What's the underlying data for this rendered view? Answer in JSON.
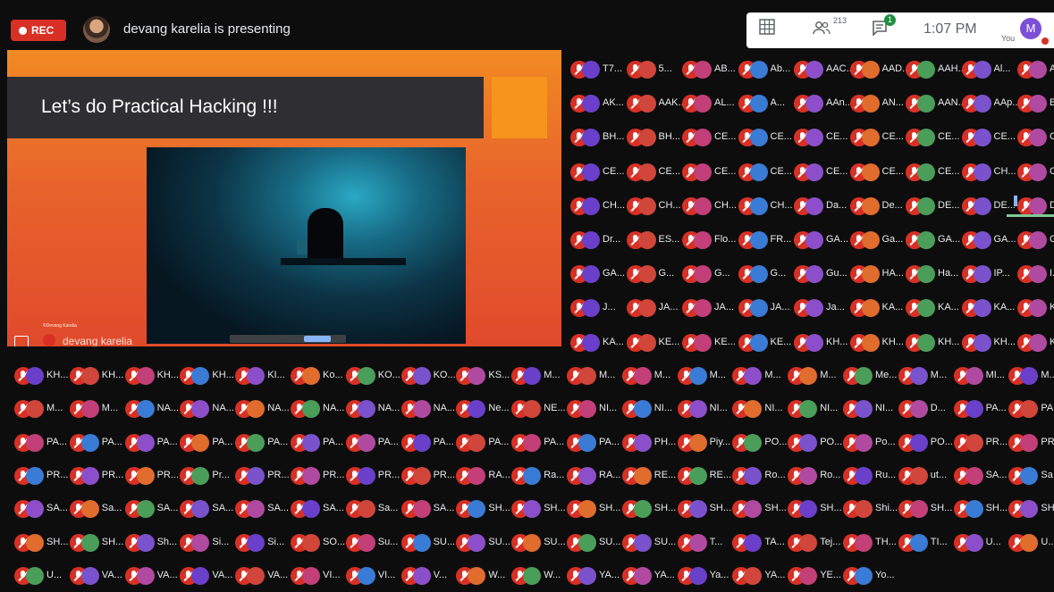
{
  "topbar": {
    "rec_label": "REC",
    "presenting_text": "devang karelia is presenting",
    "people_count": "213",
    "chat_badge": "1",
    "time": "1:07 PM",
    "you_label": "You",
    "you_initial": "M",
    "accent_rec": "#d93025"
  },
  "presentation": {
    "slide_title": "Let’s do Practical Hacking !!!",
    "presenter_name": "devang karelia",
    "credit_text": "©Devang Karelia"
  },
  "participants": [
    "T7...",
    "5...",
    "AB...",
    "Ab...",
    "AAC...",
    "AAD...",
    "AAH...",
    "Al...",
    "Aja",
    "AK...",
    "AAK...",
    "AL...",
    "A...",
    "AAn...",
    "AN...",
    "AAN...",
    "AAp...",
    "BA",
    "BH...",
    "BH...",
    "CE...",
    "CE...",
    "CE...",
    "CE...",
    "CE...",
    "CE...",
    "CE",
    "CE...",
    "CE...",
    "CE...",
    "CE...",
    "CE...",
    "CE...",
    "CE...",
    "CH...",
    "CH",
    "CH...",
    "CH...",
    "CH...",
    "CH...",
    "Da...",
    "De...",
    "DE...",
    "DE...",
    "De...",
    "Dr...",
    "ES...",
    "Flo...",
    "FR...",
    "GA...",
    "Ga...",
    "GA...",
    "GA...",
    "GA",
    "GA...",
    "G...",
    "G...",
    "G...",
    "Gu...",
    "HA...",
    "Ha...",
    "IP...",
    "I...",
    "J...",
    "JA...",
    "JA...",
    "JA...",
    "Ja...",
    "KA...",
    "KA...",
    "KA...",
    "KA",
    "KA...",
    "KE...",
    "KE...",
    "KE...",
    "KH...",
    "KH...",
    "KH...",
    "KH...",
    "KH",
    "KH...",
    "KH...",
    "KH...",
    "KH...",
    "KI...",
    "Ko...",
    "KO...",
    "KO...",
    "KS...",
    "M...",
    "M...",
    "M...",
    "M...",
    "M...",
    "M...",
    "Me...",
    "M...",
    "MI...",
    "M...",
    "M...",
    "M...",
    "NA...",
    "NA...",
    "NA...",
    "NA...",
    "NA...",
    "NA...",
    "Ne...",
    "NE...",
    "NI...",
    "NI...",
    "NI...",
    "NI...",
    "NI...",
    "NI...",
    "D...",
    "PA...",
    "PA",
    "PA...",
    "PA...",
    "PA...",
    "PA...",
    "PA...",
    "PA...",
    "PA...",
    "PA...",
    "PA...",
    "PA...",
    "PA...",
    "PH...",
    "Piy...",
    "PO...",
    "PO...",
    "Po...",
    "PO...",
    "PR...",
    "PR",
    "PR...",
    "PR...",
    "PR...",
    "Pr...",
    "PR...",
    "PR...",
    "PR...",
    "PR...",
    "RA...",
    "Ra...",
    "RA...",
    "RE...",
    "RE...",
    "Ro...",
    "Ro...",
    "Ru...",
    "ut...",
    "SA...",
    "Sa",
    "SA...",
    "Sa...",
    "SA...",
    "SA...",
    "SA...",
    "SA...",
    "Sa...",
    "SA...",
    "SH...",
    "SH...",
    "SH...",
    "SH...",
    "SH...",
    "SH...",
    "SH...",
    "Shi...",
    "SH...",
    "SH...",
    "SH",
    "SH...",
    "SH...",
    "Sh...",
    "Si...",
    "Si...",
    "SO...",
    "Su...",
    "SU...",
    "SU...",
    "SU...",
    "SU...",
    "SU...",
    "T...",
    "TA...",
    "Tej...",
    "TH...",
    "TI...",
    "U...",
    "U...",
    "U...",
    "VA...",
    "VA...",
    "VA...",
    "VA...",
    "VI...",
    "VI...",
    "V...",
    "W...",
    "W...",
    "YA...",
    "YA...",
    "Ya...",
    "YA...",
    "YE...",
    "Yo..."
  ]
}
